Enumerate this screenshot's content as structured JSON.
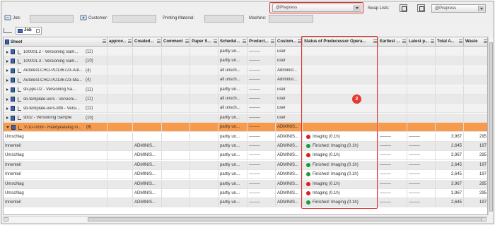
{
  "filters": {
    "job_label": "Job:",
    "customer_label": "Customer:",
    "printing_material_label": "Printing Material:",
    "machine_label": "Machine:"
  },
  "list_dropdown": {
    "value": "@Prepress"
  },
  "swap_lists": {
    "label": "Swap Lists:",
    "value": "@Prepress"
  },
  "tab": {
    "label": "Job"
  },
  "columns": [
    "Sheet",
    "approv...",
    "Created...",
    "Comment",
    "Paper S...",
    "Schedul...",
    "Product...",
    "Custom...",
    "Status of Predecessor Opera...",
    "Earliest ...",
    "Latest p...",
    "Total A...",
    "Waste"
  ],
  "group_rows": [
    {
      "sheet": "100001.2 - Versioning Sam...",
      "count": "(11)",
      "scheduled": "partly un...",
      "product": "--------",
      "customer": "user"
    },
    {
      "sheet": "100001.3 - Versioning Sam...",
      "count": "(10)",
      "scheduled": "partly un...",
      "product": "--------",
      "customer": "user"
    },
    {
      "sheet": "Autotest-CHO-PD136723-Aut...",
      "count": "(4)",
      "scheduled": "all unsch...",
      "product": "--------",
      "customer": "Administ..."
    },
    {
      "sheet": "Autotest-CHO-PD136723-Ma...",
      "count": "(4)",
      "scheduled": "all unsch...",
      "product": "--------",
      "customer": "Administ..."
    },
    {
      "sheet": "sb-pps-02 - Versioning Sa...",
      "count": "(11)",
      "scheduled": "partly un...",
      "product": "--------",
      "customer": "user"
    },
    {
      "sheet": "sb-template-vers - Versioni...",
      "count": "(11)",
      "scheduled": "all unsch...",
      "product": "--------",
      "customer": "user"
    },
    {
      "sheet": "sb-template-vers-tiffb - Versi...",
      "count": "(11)",
      "scheduled": "all unsch...",
      "product": "--------",
      "customer": "user"
    },
    {
      "sheet": "sb02 - Versioning Sample",
      "count": "(10)",
      "scheduled": "partly un...",
      "product": "--------",
      "customer": "user"
    }
  ],
  "selected_group": {
    "sheet": "V-10-0039 - Handykatalog in...",
    "count": "(8)",
    "scheduled": "partly un...",
    "product": "--------",
    "customer": "ADMINIS..."
  },
  "detail_rows": [
    {
      "sheet": "Umschlag",
      "created": "",
      "scheduled": "partly un...",
      "product": "--------",
      "customer": "ADMINIS...",
      "status": "Imaging (0.1h)",
      "status_color": "#d81e1e",
      "earliest": "--------",
      "latest": "--------",
      "total": "3,967",
      "waste": "295"
    },
    {
      "sheet": "Innenteil",
      "created": "ADMINIS...",
      "scheduled": "partly un...",
      "product": "--------",
      "customer": "ADMINIS...",
      "status": "Finished: Imaging (0.1h)",
      "status_color": "#1e9a3a",
      "earliest": "--------",
      "latest": "--------",
      "total": "2,645",
      "waste": "197"
    },
    {
      "sheet": "Umschlag",
      "created": "ADMINIS...",
      "scheduled": "partly un...",
      "product": "--------",
      "customer": "ADMINIS...",
      "status": "Imaging (0.1h)",
      "status_color": "#d81e1e",
      "earliest": "--------",
      "latest": "--------",
      "total": "3,967",
      "waste": "295"
    },
    {
      "sheet": "Innenteil",
      "created": "ADMINIS...",
      "scheduled": "partly un...",
      "product": "--------",
      "customer": "ADMINIS...",
      "status": "Finished: Imaging (0.1h)",
      "status_color": "#1e9a3a",
      "earliest": "--------",
      "latest": "--------",
      "total": "2,645",
      "waste": "197"
    },
    {
      "sheet": "Innenteil",
      "created": "ADMINIS...",
      "scheduled": "partly un...",
      "product": "--------",
      "customer": "ADMINIS...",
      "status": "Finished: Imaging (0.1h)",
      "status_color": "#1e9a3a",
      "earliest": "--------",
      "latest": "--------",
      "total": "2,645",
      "waste": "197"
    },
    {
      "sheet": "Umschlag",
      "created": "ADMINIS...",
      "scheduled": "partly un...",
      "product": "--------",
      "customer": "ADMINIS...",
      "status": "Imaging (0.1h)",
      "status_color": "#d81e1e",
      "earliest": "--------",
      "latest": "--------",
      "total": "3,967",
      "waste": "295"
    },
    {
      "sheet": "Umschlag",
      "created": "ADMINIS...",
      "scheduled": "partly un...",
      "product": "--------",
      "customer": "ADMINIS...",
      "status": "Imaging (0.1h)",
      "status_color": "#d81e1e",
      "earliest": "--------",
      "latest": "--------",
      "total": "3,967",
      "waste": "295"
    },
    {
      "sheet": "Innenteil",
      "created": "ADMINIS...",
      "scheduled": "partly un...",
      "product": "--------",
      "customer": "ADMINIS...",
      "status": "Finished: Imaging (0.1h)",
      "status_color": "#1e9a3a",
      "earliest": "--------",
      "latest": "--------",
      "total": "2,645",
      "waste": "197"
    }
  ],
  "annotation_badge": "2",
  "colors": {
    "highlight": "#e0302a",
    "selected_row": "#f79a4c",
    "red_status": "#d81e1e",
    "green_status": "#1e9a3a"
  }
}
